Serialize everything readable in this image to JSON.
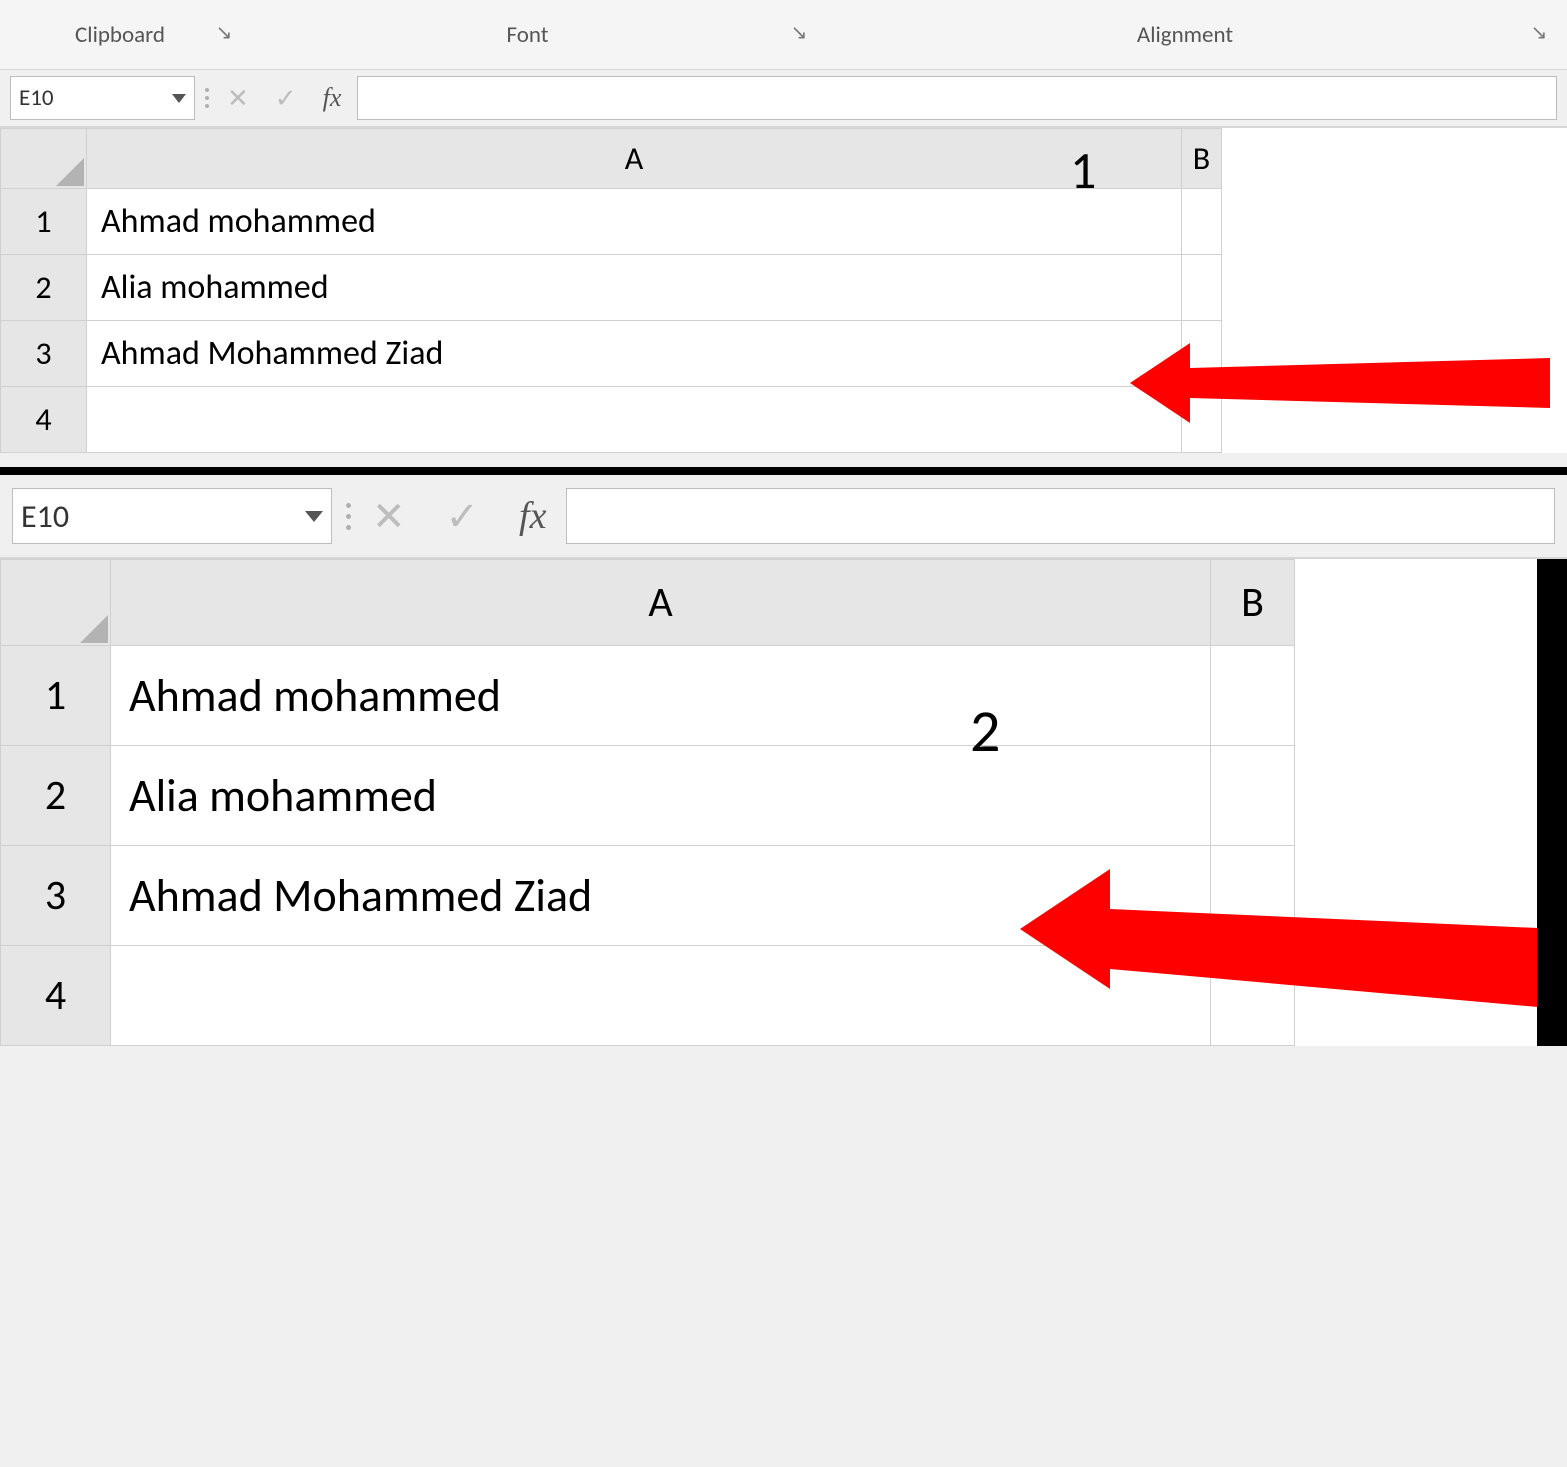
{
  "ribbon_groups": {
    "clipboard": "Clipboard",
    "font": "Font",
    "alignment": "Alignment"
  },
  "panel1": {
    "namebox": "E10",
    "fx_label": "fx",
    "formula_value": "",
    "columns": [
      "A",
      "B"
    ],
    "rows": [
      "1",
      "2",
      "3",
      "4"
    ],
    "cells_a": [
      "Ahmad mohammed",
      "Alia mohammed",
      "Ahmad Mohammed Ziad",
      ""
    ],
    "annotation": "1"
  },
  "panel2": {
    "namebox": "E10",
    "fx_label": "fx",
    "formula_value": "",
    "columns": [
      "A",
      "B"
    ],
    "rows": [
      "1",
      "2",
      "3",
      "4"
    ],
    "cells_a": [
      "Ahmad mohammed",
      "Alia mohammed",
      "Ahmad Mohammed Ziad",
      ""
    ],
    "annotation": "2"
  }
}
